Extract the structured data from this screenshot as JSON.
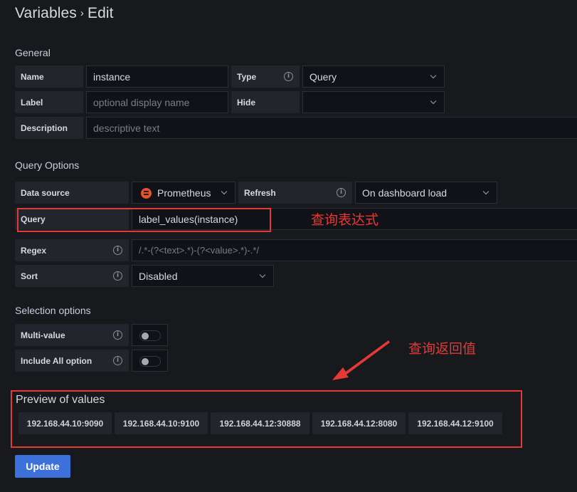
{
  "header": {
    "title": "Variables",
    "separator": "›",
    "subtitle": "Edit"
  },
  "general": {
    "heading": "General",
    "name": {
      "label": "Name",
      "value": "instance"
    },
    "type": {
      "label": "Type",
      "value": "Query"
    },
    "label": {
      "label": "Label",
      "placeholder": "optional display name"
    },
    "hide": {
      "label": "Hide",
      "value": ""
    },
    "description": {
      "label": "Description",
      "placeholder": "descriptive text"
    }
  },
  "query_options": {
    "heading": "Query Options",
    "data_source": {
      "label": "Data source",
      "value": "Prometheus",
      "icon": "prometheus-icon",
      "icon_color": "#e6522c"
    },
    "refresh": {
      "label": "Refresh",
      "value": "On dashboard load"
    },
    "query": {
      "label": "Query",
      "value": "label_values(instance)"
    },
    "regex": {
      "label": "Regex",
      "placeholder": "/.*-(?<text>.*)-(?<value>.*)-.*/"
    },
    "sort": {
      "label": "Sort",
      "value": "Disabled"
    }
  },
  "selection_options": {
    "heading": "Selection options",
    "multi_value": {
      "label": "Multi-value",
      "enabled": false
    },
    "include_all": {
      "label": "Include All option",
      "enabled": false
    }
  },
  "preview": {
    "heading": "Preview of values",
    "values": [
      "192.168.44.10:9090",
      "192.168.44.10:9100",
      "192.168.44.12:30888",
      "192.168.44.12:8080",
      "192.168.44.12:9100"
    ]
  },
  "annotations": {
    "query_note": "查询表达式",
    "preview_note": "查询返回值",
    "color": "#e53935"
  },
  "actions": {
    "update_label": "Update"
  }
}
